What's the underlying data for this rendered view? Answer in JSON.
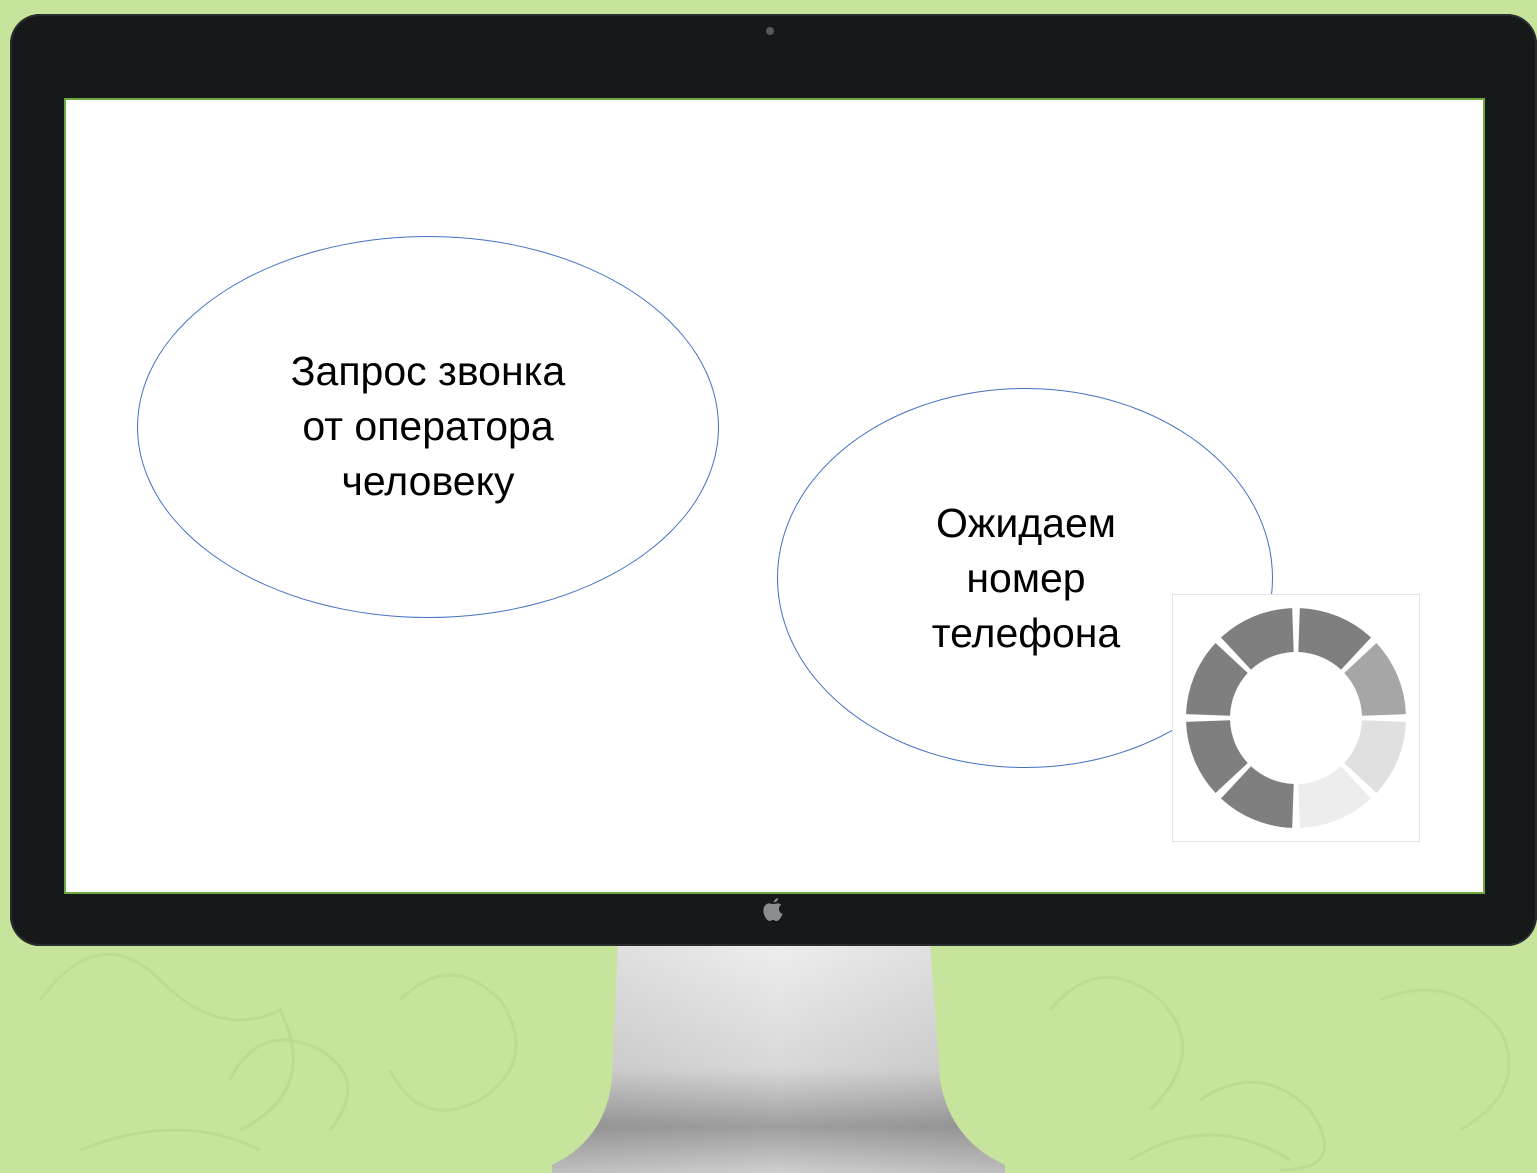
{
  "slide": {
    "bubble_1": "Запрос звонка\nот оператора\nчеловеку",
    "bubble_2": "Ожидаем\nномер\nтелефона"
  },
  "spinner": {
    "icon": "loading-spinner-icon",
    "segment_colors": [
      "#7f7f7f",
      "#a6a6a6",
      "#e0e0e0",
      "#ededed",
      "#7f7f7f",
      "#7f7f7f",
      "#7f7f7f",
      "#7f7f7f"
    ]
  },
  "colors": {
    "background": "#c6e49c",
    "bezel": "#17181a",
    "screen_border": "#6ea843",
    "ellipse_outline": "#4472c4"
  }
}
